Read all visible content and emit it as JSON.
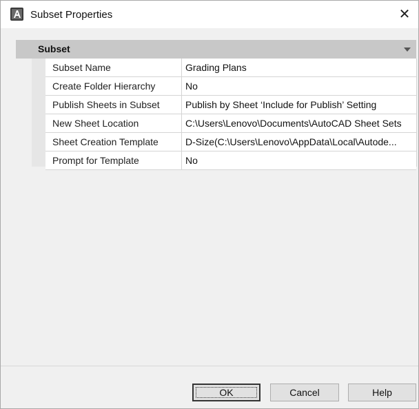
{
  "window": {
    "title": "Subset Properties",
    "icon": "autocad-app-icon",
    "close_glyph": "✕"
  },
  "section": {
    "title": "Subset",
    "collapse_icon": "chevron-down-icon"
  },
  "properties": [
    {
      "name": "Subset Name",
      "value": "Grading Plans"
    },
    {
      "name": "Create Folder Hierarchy",
      "value": "No"
    },
    {
      "name": "Publish Sheets in Subset",
      "value": "Publish by Sheet ‘Include for Publish’ Setting"
    },
    {
      "name": "New Sheet Location",
      "value": "C:\\Users\\Lenovo\\Documents\\AutoCAD Sheet Sets"
    },
    {
      "name": "Sheet Creation Template",
      "value": "D-Size(C:\\Users\\Lenovo\\AppData\\Local\\Autode..."
    },
    {
      "name": "Prompt for Template",
      "value": "No"
    }
  ],
  "buttons": {
    "ok": "OK",
    "cancel": "Cancel",
    "help": "Help"
  }
}
